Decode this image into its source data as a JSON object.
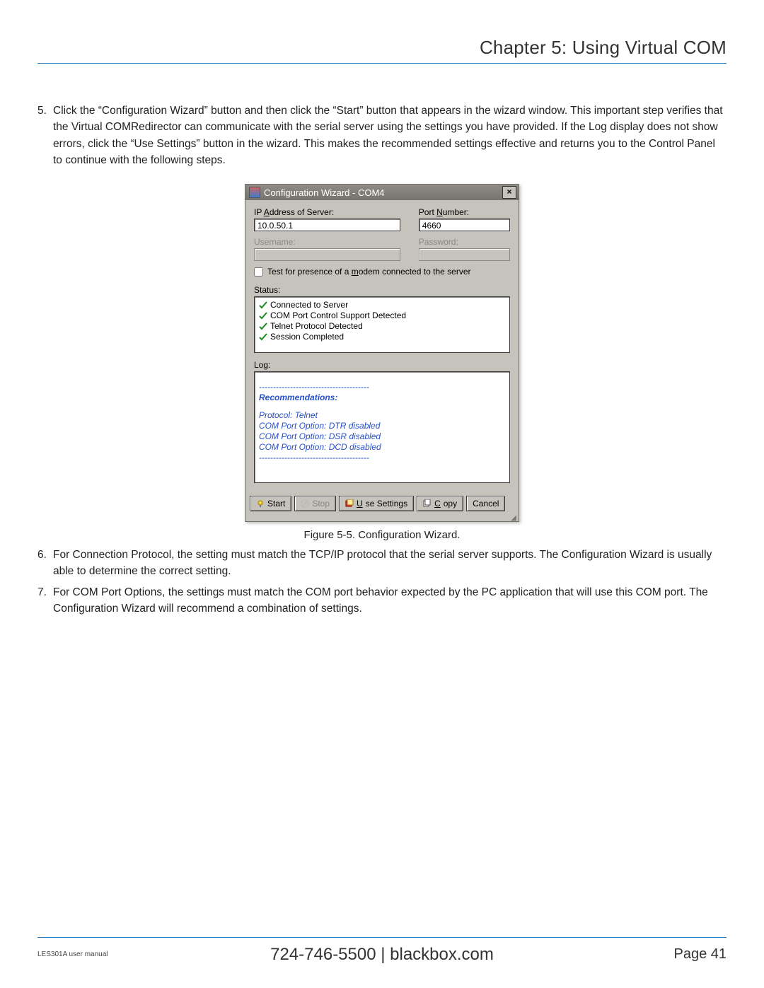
{
  "header": {
    "chapter_title": "Chapter 5: Using Virtual COM"
  },
  "steps_a": [
    {
      "num": "5.",
      "text": "Click the “Configuration Wizard” button and then click the “Start” button that appears in the wizard window. This important step verifies that the Virtual COMRedirector can communicate with the serial server using the settings you have provided. If the Log display does not show errors, click the “Use Settings” button in the wizard. This makes the recommended settings effective and returns you to the Control Panel to continue with the following steps."
    }
  ],
  "dialog": {
    "title": "Configuration Wizard - COM4",
    "fields": {
      "ip_label": "IP Address of Server:",
      "ip_accel": "A",
      "ip_value": "10.0.50.1",
      "port_label": "Port Number:",
      "port_accel": "N",
      "port_value": "4660",
      "user_label": "Username:",
      "user_value": "",
      "pass_label": "Password:",
      "pass_value": ""
    },
    "modem_check_pre": "Test for presence of a ",
    "modem_check_u": "m",
    "modem_check_post": "odem connected to the server",
    "modem_checked": false,
    "status_label": "Status:",
    "status_items": [
      "Connected to Server",
      "COM Port Control Support Detected",
      "Telnet Protocol Detected",
      "Session Completed"
    ],
    "log_label": "Log:",
    "log_rule": "---------------------------------------",
    "log_header": "Recommendations:",
    "log_lines": [
      "Protocol: Telnet",
      "COM Port Option: DTR disabled",
      "COM Port Option: DSR disabled",
      "COM Port Option: DCD disabled"
    ],
    "buttons": {
      "start": "Start",
      "stop": "Stop",
      "use_u": "U",
      "use_rest": "se Settings",
      "copy_u": "C",
      "copy_rest": "opy",
      "cancel": "Cancel"
    }
  },
  "figure_caption": "Figure 5-5. Configuration Wizard.",
  "steps_b": [
    {
      "num": "6.",
      "text": "For Connection Protocol, the setting must match the TCP/IP protocol that the serial server supports. The Configuration Wizard is usually able to determine the correct setting."
    },
    {
      "num": "7.",
      "text": "For COM Port Options, the settings must match the COM port behavior expected by the PC application that will use this COM port. The Configuration Wizard will recommend a combination of settings."
    }
  ],
  "footer": {
    "left": "LES301A user manual",
    "center": "724-746-5500   |   blackbox.com",
    "right": "Page 41"
  }
}
